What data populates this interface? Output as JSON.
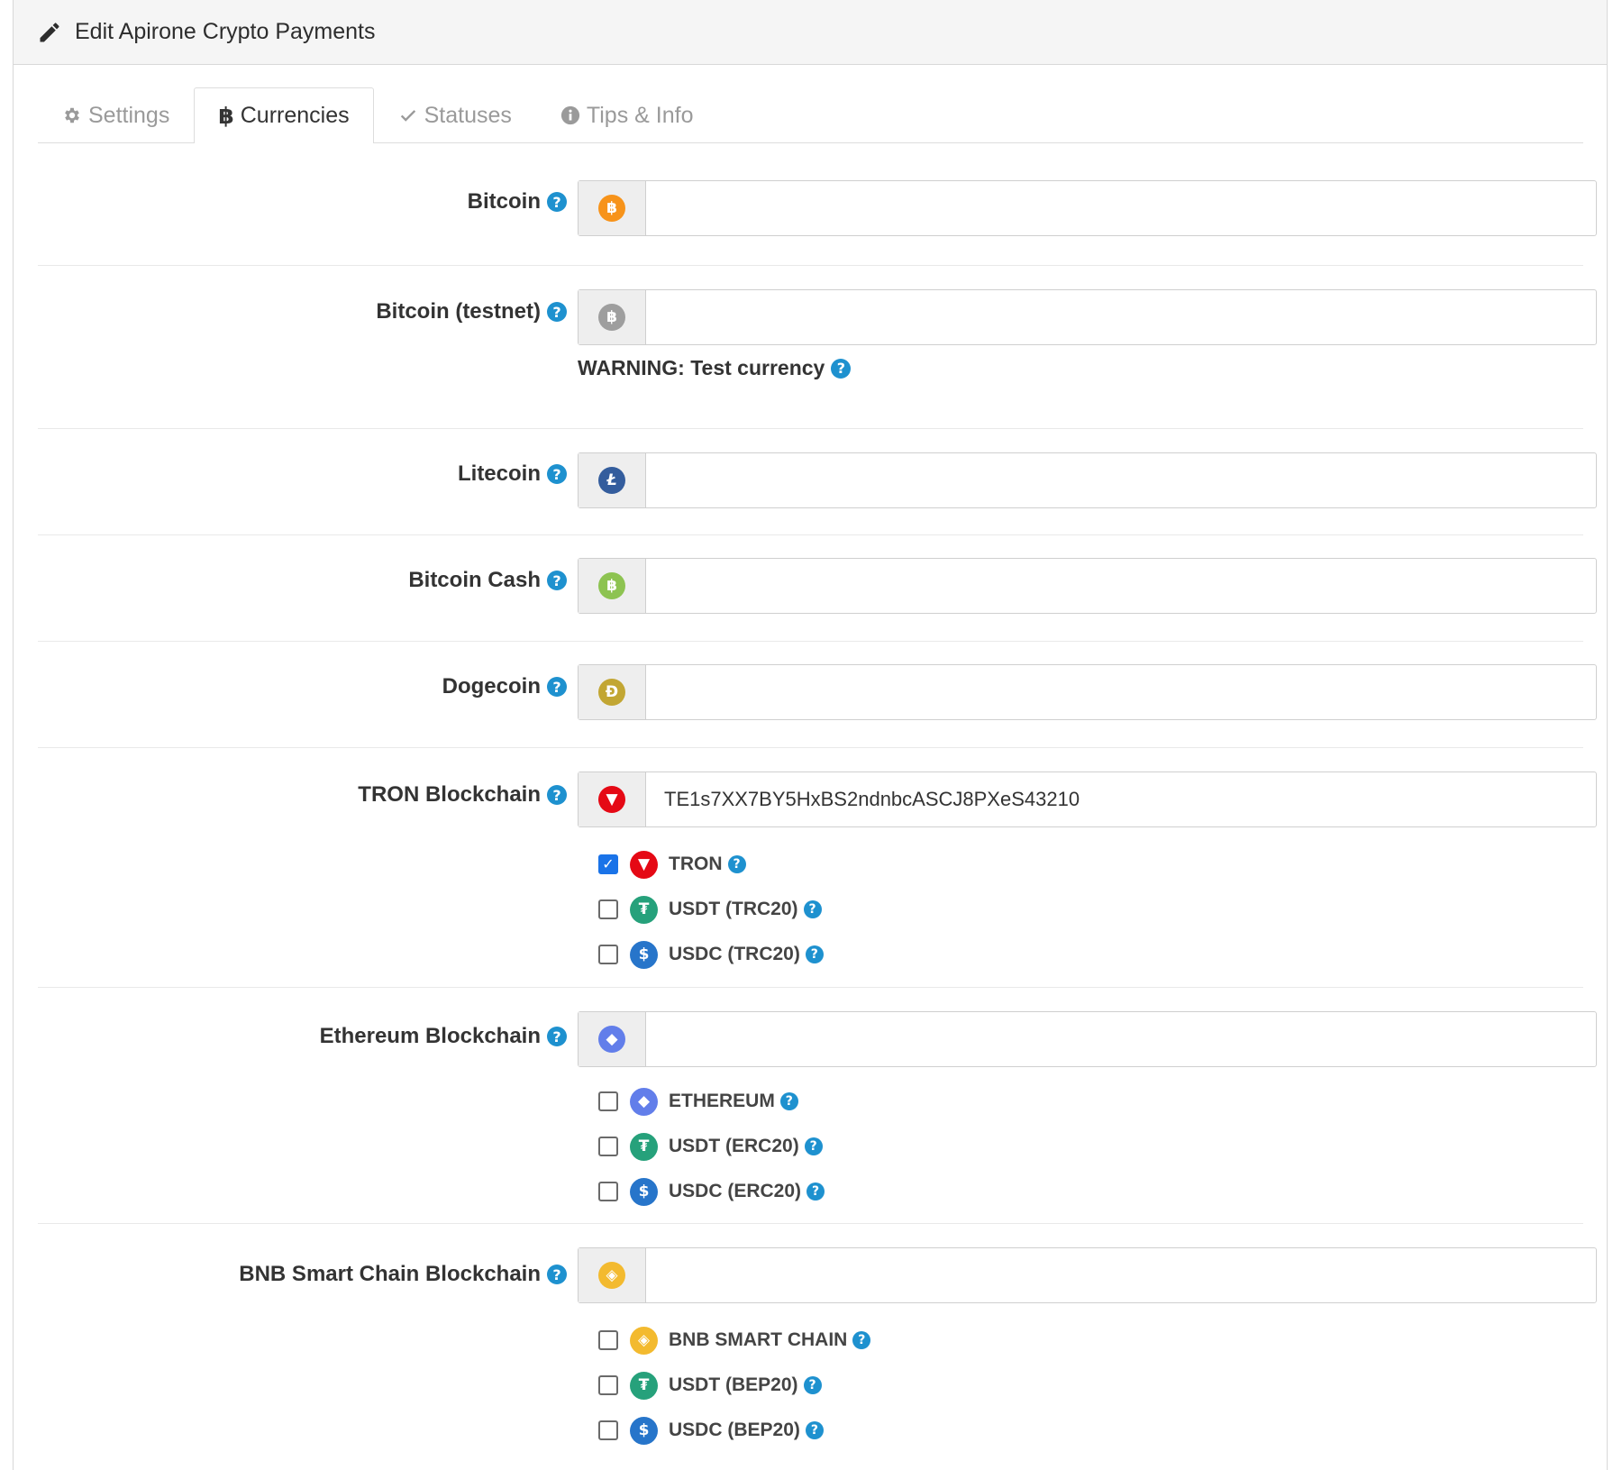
{
  "header": {
    "title": "Edit Apirone Crypto Payments"
  },
  "tabs": [
    {
      "label": "Settings",
      "icon": "gear-icon"
    },
    {
      "label": "Currencies",
      "icon": "bitcoin-icon"
    },
    {
      "label": "Statuses",
      "icon": "check-icon"
    },
    {
      "label": "Tips & Info",
      "icon": "info-icon"
    }
  ],
  "help_glyph": "?",
  "currencies": {
    "btc": {
      "label": "Bitcoin",
      "value": "",
      "icon": "bitcoin-icon",
      "color": "#f7931a"
    },
    "tbtc": {
      "label": "Bitcoin (testnet)",
      "value": "",
      "icon": "bitcoin-testnet-icon",
      "color": "#9e9e9e",
      "warning": "WARNING: Test currency"
    },
    "ltc": {
      "label": "Litecoin",
      "value": "",
      "icon": "litecoin-icon",
      "color": "#345d9d"
    },
    "bch": {
      "label": "Bitcoin Cash",
      "value": "",
      "icon": "bitcoin-cash-icon",
      "color": "#8dc351"
    },
    "doge": {
      "label": "Dogecoin",
      "value": "",
      "icon": "dogecoin-icon",
      "color": "#c2a633"
    },
    "tron": {
      "label": "TRON Blockchain",
      "value": "TE1s7XX7BY5HxBS2ndnbcASCJ8PXeS43210",
      "icon": "tron-icon",
      "color": "#e50915",
      "tokens": [
        {
          "label": "TRON",
          "checked": true,
          "icon": "tron-icon"
        },
        {
          "label": "USDT (TRC20)",
          "checked": false,
          "icon": "tether-icon"
        },
        {
          "label": "USDC (TRC20)",
          "checked": false,
          "icon": "usdc-icon"
        }
      ]
    },
    "eth": {
      "label": "Ethereum Blockchain",
      "value": "",
      "icon": "ethereum-icon",
      "color": "#627eea",
      "tokens": [
        {
          "label": "ETHEREUM",
          "checked": false,
          "icon": "ethereum-icon"
        },
        {
          "label": "USDT (ERC20)",
          "checked": false,
          "icon": "tether-icon"
        },
        {
          "label": "USDC (ERC20)",
          "checked": false,
          "icon": "usdc-icon"
        }
      ]
    },
    "bnb": {
      "label": "BNB Smart Chain Blockchain",
      "value": "",
      "icon": "bnb-icon",
      "color": "#f3ba2f",
      "tokens": [
        {
          "label": "BNB SMART CHAIN",
          "checked": false,
          "icon": "bnb-icon"
        },
        {
          "label": "USDT (BEP20)",
          "checked": false,
          "icon": "tether-icon"
        },
        {
          "label": "USDC (BEP20)",
          "checked": false,
          "icon": "usdc-icon"
        }
      ]
    }
  },
  "colors": {
    "help": "#1e91cf",
    "checkbox_checked": "#1a73e8",
    "tether": "#26a17b",
    "usdc": "#2775ca"
  }
}
